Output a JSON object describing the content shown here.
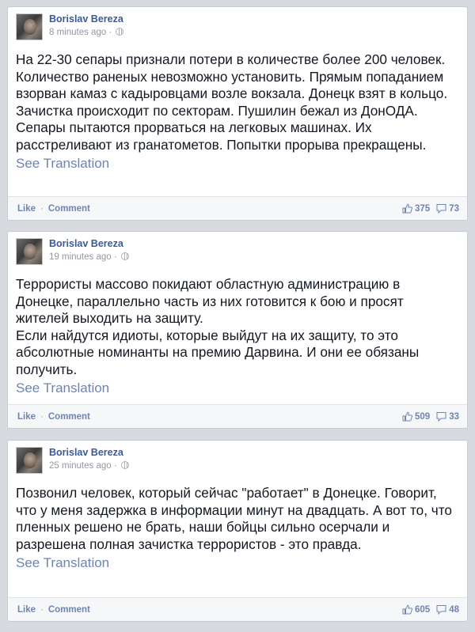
{
  "posts": [
    {
      "author": "Borislav Bereza",
      "time": "8 minutes ago ·",
      "paragraphs": [
        "На 22-30 сепары признали потери в количестве более 200 человек. Количество раненых невозможно установить. Прямым попаданием взорван камаз с кадыровцами возле вокзала. Донецк взят в кольцо. Зачистка происходит по секторам. Пушилин бежал из ДонОДА. Сепары пытаются прорваться на легковых машинах. Их расстреливают из гранатометов. Попытки прорыва прекращены."
      ],
      "see_translation": "See Translation",
      "like_label": "Like",
      "sep": "·",
      "comment_label": "Comment",
      "likes": "375",
      "comments": "73"
    },
    {
      "author": "Borislav Bereza",
      "time": "19 minutes ago ·",
      "paragraphs": [
        "Террористы массово покидают областную администрацию в Донецке, параллельно часть из них готовится к бою и просят жителей выходить на защиту.",
        "Если найдутся идиоты, которые выйдут на их защиту, то это абсолютные номинанты на премию Дарвина. И они ее обязаны получить."
      ],
      "see_translation": "See Translation",
      "like_label": "Like",
      "sep": "·",
      "comment_label": "Comment",
      "likes": "509",
      "comments": "33"
    },
    {
      "author": "Borislav Bereza",
      "time": "25 minutes ago ·",
      "paragraphs": [
        "Позвонил человек, который сейчас \"работает\" в Донецке. Говорит, что у меня задержка в информации минут на двадцать. А вот то, что пленных решено не брать, наши бойцы сильно осерчали и разрешена полная зачистка террористов - это правда."
      ],
      "see_translation": "See Translation",
      "like_label": "Like",
      "sep": "·",
      "comment_label": "Comment",
      "likes": "605",
      "comments": "48"
    }
  ],
  "colors": {
    "link": "#6d84b4",
    "author": "#3b5998",
    "text": "#141823",
    "meta": "#9197a3",
    "background": "#d7dade"
  },
  "icons": {
    "like": "thumbs-up-icon",
    "comment": "comment-bubble-icon",
    "privacy": "globe-icon"
  }
}
